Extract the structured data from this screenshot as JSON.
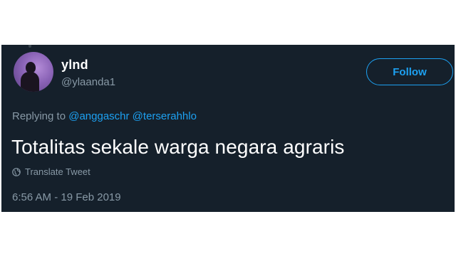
{
  "tweet": {
    "display_name": "ylnd",
    "handle": "@ylaanda1",
    "follow_label": "Follow",
    "replying_prefix": "Replying to",
    "replying_to": [
      "@anggaschr",
      "@terserahhlo"
    ],
    "text": "Totalitas sekale warga negara agraris",
    "translate_label": "Translate Tweet",
    "timestamp": "6:56 AM - 19 Feb 2019"
  },
  "colors": {
    "background": "#15202b",
    "accent": "#1da1f2",
    "secondary_text": "#8899a6",
    "primary_text": "#ffffff"
  },
  "icons": {
    "translate": "globe-icon"
  }
}
